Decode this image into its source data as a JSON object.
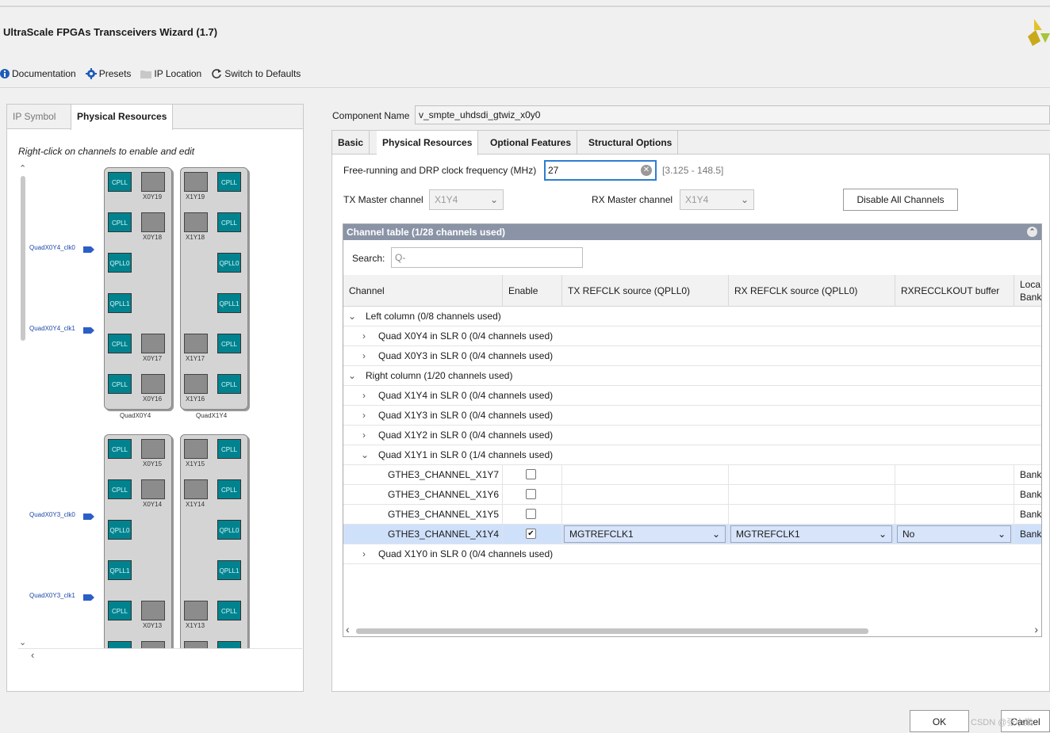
{
  "window": {
    "title": "UltraScale FPGAs Transceivers Wizard (1.7)"
  },
  "toolbar": {
    "documentation": "Documentation",
    "presets": "Presets",
    "ip_location": "IP Location",
    "switch_defaults": "Switch to Defaults"
  },
  "left_panel": {
    "tabs": [
      "IP Symbol",
      "Physical Resources"
    ],
    "active_tab": "Physical Resources",
    "hint": "Right-click on channels to enable and edit",
    "blocks": {
      "cpll": "CPLL",
      "qpll0": "QPLL0",
      "qpll1": "QPLL1"
    },
    "quad_groups": [
      {
        "left_quad": "QuadX0Y4",
        "right_quad": "QuadX1Y4",
        "clk0": "QuadX0Y4_clk0",
        "clk1": "QuadX0Y4_clk1",
        "left_channels": [
          "X0Y19",
          "X0Y18",
          "X0Y17",
          "X0Y16"
        ],
        "right_channels": [
          "X1Y19",
          "X1Y18",
          "X1Y17",
          "X1Y16"
        ]
      },
      {
        "left_quad": "",
        "right_quad": "",
        "clk0": "QuadX0Y3_clk0",
        "clk1": "QuadX0Y3_clk1",
        "left_channels": [
          "X0Y15",
          "X0Y14",
          "X0Y13",
          ""
        ],
        "right_channels": [
          "X1Y15",
          "X1Y14",
          "X1Y13",
          ""
        ]
      }
    ]
  },
  "component": {
    "label": "Component Name",
    "value": "v_smpte_uhdsdi_gtwiz_x0y0"
  },
  "right_tabs": [
    "Basic",
    "Physical Resources",
    "Optional Features",
    "Structural Options"
  ],
  "active_right_tab": "Physical Resources",
  "freq": {
    "label": "Free-running and DRP clock frequency (MHz)",
    "value": "27",
    "range": "[3.125 - 148.5]"
  },
  "tx_master": {
    "label": "TX Master channel",
    "value": "X1Y4"
  },
  "rx_master": {
    "label": "RX Master channel",
    "value": "X1Y4"
  },
  "disable_all_label": "Disable All Channels",
  "channel_table": {
    "title": "Channel table (1/28 channels used)",
    "search_label": "Search:",
    "search_placeholder": "Q-",
    "columns": [
      "Channel",
      "Enable",
      "TX REFCLK source (QPLL0)",
      "RX REFCLK source (QPLL0)",
      "RXRECCLKOUT buffer",
      "Loca"
    ],
    "col_last_line2": "Bank",
    "rows": [
      {
        "kind": "group",
        "label": "Left column (0/8 channels used)",
        "expanded": true
      },
      {
        "kind": "quad",
        "label": "Quad X0Y4 in SLR 0 (0/4 channels used)",
        "expanded": false
      },
      {
        "kind": "quad",
        "label": "Quad X0Y3 in SLR 0 (0/4 channels used)",
        "expanded": false
      },
      {
        "kind": "group",
        "label": "Right column (1/20 channels used)",
        "expanded": true
      },
      {
        "kind": "quad",
        "label": "Quad X1Y4 in SLR 0 (0/4 channels used)",
        "expanded": false
      },
      {
        "kind": "quad",
        "label": "Quad X1Y3 in SLR 0 (0/4 channels used)",
        "expanded": false
      },
      {
        "kind": "quad",
        "label": "Quad X1Y2 in SLR 0 (0/4 channels used)",
        "expanded": false
      },
      {
        "kind": "quad",
        "label": "Quad X1Y1 in SLR 0 (1/4 channels used)",
        "expanded": true
      },
      {
        "kind": "channel",
        "label": "GTHE3_CHANNEL_X1Y7",
        "enabled": false,
        "tx": "",
        "rx": "",
        "buf": "",
        "loc": "Bank"
      },
      {
        "kind": "channel",
        "label": "GTHE3_CHANNEL_X1Y6",
        "enabled": false,
        "tx": "",
        "rx": "",
        "buf": "",
        "loc": "Bank"
      },
      {
        "kind": "channel",
        "label": "GTHE3_CHANNEL_X1Y5",
        "enabled": false,
        "tx": "",
        "rx": "",
        "buf": "",
        "loc": "Bank"
      },
      {
        "kind": "channel",
        "label": "GTHE3_CHANNEL_X1Y4",
        "enabled": true,
        "tx": "MGTREFCLK1",
        "rx": "MGTREFCLK1",
        "buf": "No",
        "loc": "Bank",
        "selected": true
      },
      {
        "kind": "quad",
        "label": "Quad X1Y0 in SLR 0 (0/4 channels used)",
        "expanded": false
      }
    ]
  },
  "buttons": {
    "ok": "OK",
    "cancel": "Cancel"
  },
  "watermark": "CSDN @张小樂",
  "colors": {
    "accent": "#2f7dd1",
    "teal_block": "#00838f",
    "table_header": "#8a94a6",
    "selected_row": "#cfe0fb"
  }
}
